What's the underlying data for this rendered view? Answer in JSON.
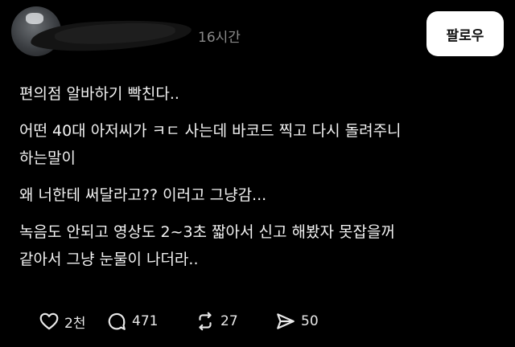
{
  "post": {
    "timestamp": "16시간",
    "follow_label": "팔로우",
    "paragraphs": [
      {
        "lines": [
          "편의점 알바하기 빡친다.."
        ]
      },
      {
        "lines": [
          "어떤 40대 아저씨가 ㅋㄷ 사는데 바코드 찍고 다시 돌려주니",
          "하는말이"
        ]
      },
      {
        "lines": [
          "왜 너한테 써달라고?? 이러고 그냥감..."
        ]
      },
      {
        "lines": [
          "녹음도 안되고 영상도 2~3초 짧아서 신고 해봤자 못잡을꺼",
          "같아서 그냥 눈물이 나더라.."
        ]
      }
    ]
  },
  "actions": {
    "likes": "2천",
    "comments": "471",
    "reposts": "27",
    "shares": "50"
  },
  "icons": {
    "like": "heart-icon",
    "comment": "comment-bubble-icon",
    "repost": "repost-icon",
    "share": "share-send-icon"
  },
  "colors": {
    "background": "#000000",
    "text": "#f2f2f2",
    "muted": "#8a8a8a",
    "button_bg": "#ffffff",
    "button_text": "#111111"
  }
}
